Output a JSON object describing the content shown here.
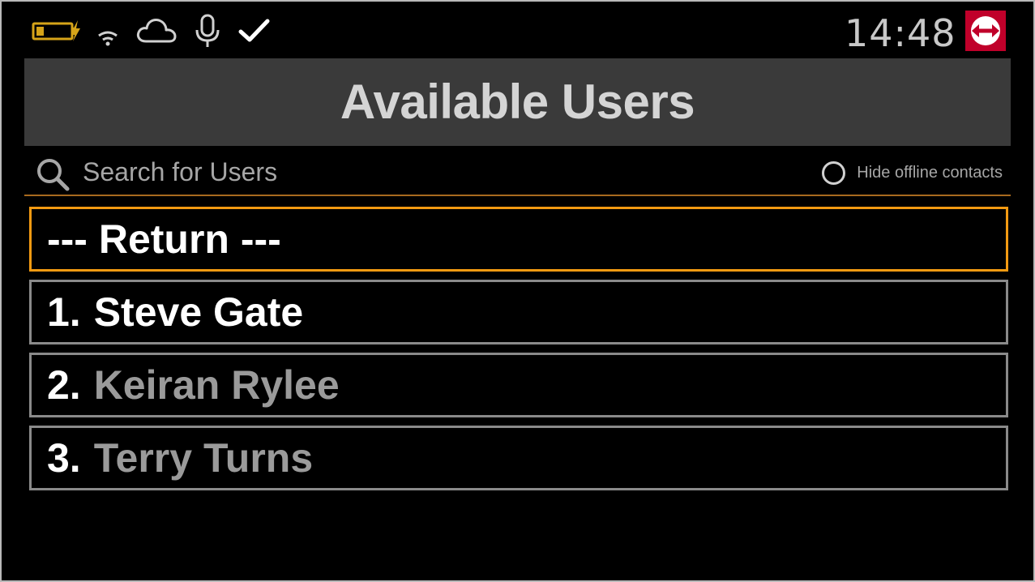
{
  "status_bar": {
    "icons": [
      "battery-charging-icon",
      "wifi-icon",
      "cloud-icon",
      "microphone-icon",
      "checkmark-icon"
    ],
    "clock": "14:48",
    "app_logo": "teamviewer-logo"
  },
  "header": {
    "title": "Available Users"
  },
  "search": {
    "placeholder": "Search for Users",
    "value": "",
    "hide_offline_label": "Hide offline contacts",
    "hide_offline_checked": false
  },
  "list": {
    "return_label": "--- Return ---",
    "users": [
      {
        "number": "1.",
        "name": "Steve Gate",
        "status": "online"
      },
      {
        "number": "2.",
        "name": "Keiran Rylee",
        "status": "offline"
      },
      {
        "number": "3.",
        "name": "Terry Turns",
        "status": "offline"
      }
    ]
  },
  "colors": {
    "accent_orange": "#f39a12",
    "divider_orange": "#a86a1e",
    "battery_yellow": "#d6a419",
    "logo_red": "#c0002a",
    "title_bar": "#3a3a3a",
    "item_border": "#8a8a8a",
    "offline_text": "#9a9a9a"
  }
}
